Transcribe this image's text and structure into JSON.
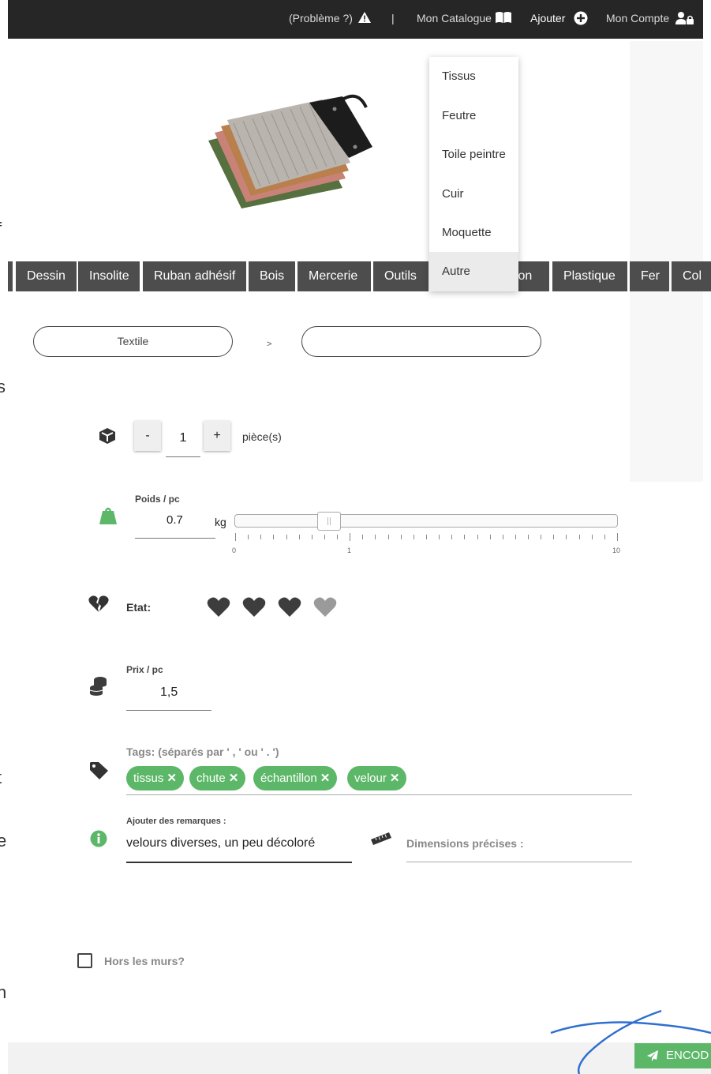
{
  "topbar": {
    "problem_label": "(Problème ?)",
    "separator": "|",
    "catalogue_label": "Mon Catalogue",
    "add_label": "Ajouter",
    "account_label": "Mon Compte"
  },
  "edge_letters": [
    "f",
    "s",
    "t",
    "e",
    "n"
  ],
  "categories": [
    "Dessin",
    "Insolite",
    "Ruban adhésif",
    "Bois",
    "Mercerie",
    "Outils",
    "ton",
    "Plastique",
    "Fer",
    "Col"
  ],
  "dropdown": {
    "items": [
      "Tissus",
      "Feutre",
      "Toile peintre",
      "Cuir",
      "Moquette",
      "Autre"
    ],
    "highlighted": "Autre"
  },
  "breadcrumb": {
    "category": "Textile",
    "separator": ">",
    "subcategory": ""
  },
  "quantity": {
    "minus_label": "-",
    "value": "1",
    "plus_label": "+",
    "unit": "pièce(s)"
  },
  "weight": {
    "label": "Poids / pc",
    "value": "0.7",
    "unit": "kg",
    "slider_value": 0.7,
    "slider_min": "0",
    "slider_mid": "1",
    "slider_max": "10"
  },
  "condition": {
    "label": "Etat:",
    "rating": 3,
    "max": 4
  },
  "price": {
    "label": "Prix / pc",
    "value": "1,5"
  },
  "tags": {
    "label": "Tags: (séparés par ' , ' ou ' . ')",
    "items": [
      "tissus",
      "chute",
      "échantillon",
      "velour"
    ],
    "remove_glyph": "✕"
  },
  "remarks": {
    "label": "Ajouter des remarques :",
    "value": "velours diverses, un peu décoloré"
  },
  "dimensions": {
    "label": "Dimensions précises :"
  },
  "outdoor": {
    "label": "Hors les murs?",
    "checked": false
  },
  "submit": {
    "label": "ENCOD"
  },
  "colors": {
    "accent_green": "#5cb868",
    "topbar_bg": "#262626",
    "tab_bg": "#4d4d4d",
    "annotation_blue": "#2f6fd0"
  }
}
